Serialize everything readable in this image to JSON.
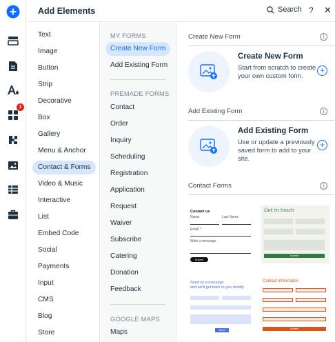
{
  "header": {
    "title": "Add Elements",
    "search_label": "Search",
    "help_label": "?",
    "close_label": "✕"
  },
  "rail": {
    "icons": [
      "add-icon",
      "menus-pages-icon",
      "pages-icon",
      "design-icon",
      "app-market-icon",
      "business-icon",
      "media-icon",
      "cms-icon",
      "portfolio-icon"
    ],
    "badge_count": "1",
    "accent": "#116dff"
  },
  "categories": [
    {
      "label": "Text"
    },
    {
      "label": "Image"
    },
    {
      "label": "Button"
    },
    {
      "label": "Strip"
    },
    {
      "label": "Decorative"
    },
    {
      "label": "Box"
    },
    {
      "label": "Gallery"
    },
    {
      "label": "Menu & Anchor"
    },
    {
      "label": "Contact & Forms"
    },
    {
      "label": "Video & Music"
    },
    {
      "label": "Interactive"
    },
    {
      "label": "List"
    },
    {
      "label": "Embed Code"
    },
    {
      "label": "Social"
    },
    {
      "label": "Payments"
    },
    {
      "label": "Input"
    },
    {
      "label": "CMS"
    },
    {
      "label": "Blog"
    },
    {
      "label": "Store"
    }
  ],
  "active_category": "Contact & Forms",
  "subcategories": {
    "my_forms_heading": "MY FORMS",
    "my_forms": [
      "Create New Form",
      "Add Existing Form"
    ],
    "premade_heading": "PREMADE FORMS",
    "premade": [
      "Contact",
      "Order",
      "Inquiry",
      "Scheduling",
      "Registration",
      "Application",
      "Request",
      "Waiver",
      "Subscribe",
      "Catering",
      "Donation",
      "Feedback"
    ],
    "maps_heading": "GOOGLE MAPS",
    "maps": [
      "Maps"
    ]
  },
  "main": {
    "create_section": "Create New Form",
    "create_card": {
      "title": "Create New Form",
      "desc": "Start from scratch to create your own custom form."
    },
    "existing_section": "Add Existing Form",
    "existing_card": {
      "title": "Add Existing Form",
      "desc": "Use or update a previously saved form to add to your site."
    },
    "contact_section": "Contact Forms",
    "thumbs": {
      "t1_title": "Contact us",
      "t1_name": "Name",
      "t1_lastname": "Last Name",
      "t1_email": "Email *",
      "t1_message": "Write a message",
      "t1_submit": "Submit",
      "t2_title": "Get in touch",
      "t2_submit": "Submit",
      "t3_title_line1": "Send us a message",
      "t3_title_line2": "and we'll get back to you shortly",
      "t3_submit": "Send",
      "t4_title": "Contact information",
      "t4_submit": "Submit"
    }
  },
  "colors": {
    "accent": "#116dff",
    "active_bg": "#d6e6fe",
    "badge": "#e62214",
    "green": "#2f7a46",
    "orange": "#d9531e"
  }
}
